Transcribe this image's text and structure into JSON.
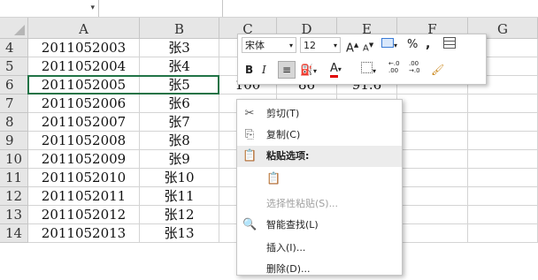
{
  "columns": [
    "A",
    "B",
    "C",
    "D",
    "E",
    "F",
    "G"
  ],
  "rows": [
    {
      "num": "4",
      "a": "2011052003",
      "b": "张3"
    },
    {
      "num": "5",
      "a": "2011052004",
      "b": "张4"
    },
    {
      "num": "6",
      "a": "2011052005",
      "b": "张5",
      "c": "100",
      "d": "86",
      "e": "91.6"
    },
    {
      "num": "7",
      "a": "2011052006",
      "b": "张6"
    },
    {
      "num": "8",
      "a": "2011052007",
      "b": "张7"
    },
    {
      "num": "9",
      "a": "2011052008",
      "b": "张8"
    },
    {
      "num": "10",
      "a": "2011052009",
      "b": "张9"
    },
    {
      "num": "11",
      "a": "2011052010",
      "b": "张10"
    },
    {
      "num": "12",
      "a": "2011052011",
      "b": "张11"
    },
    {
      "num": "13",
      "a": "2011052012",
      "b": "张12"
    },
    {
      "num": "14",
      "a": "2011052013",
      "b": "张13"
    }
  ],
  "mini_toolbar": {
    "font_name": "宋体",
    "font_size": "12",
    "grow_font": "A",
    "shrink_font": "A",
    "percent": "%",
    "comma": ",",
    "bold": "B",
    "italic": "I",
    "font_color_letter": "A",
    "inc_decimal": "←.0\n.00",
    "dec_decimal": ".00\n→.0"
  },
  "context_menu": [
    {
      "label": "剪切(T)",
      "icon": "scissors-icon",
      "state": "normal"
    },
    {
      "label": "复制(C)",
      "icon": "copy-icon",
      "state": "normal"
    },
    {
      "label": "粘贴选项:",
      "icon": "paste-icon",
      "state": "header"
    },
    {
      "label": "",
      "icon": "paste-option-icon",
      "state": "paste-row"
    },
    {
      "label": "选择性粘贴(S)...",
      "icon": "",
      "state": "disabled"
    },
    {
      "label": "智能查找(L)",
      "icon": "smart-lookup-icon",
      "state": "normal"
    },
    {
      "label": "插入(I)...",
      "icon": "",
      "state": "normal"
    },
    {
      "label": "删除(D)...",
      "icon": "",
      "state": "normal"
    }
  ],
  "colors": {
    "header_bg": "#e6e6e6",
    "grid": "#d4d4d4",
    "font_color_bar": "#e00000",
    "fill_bar": "#ffff00"
  }
}
